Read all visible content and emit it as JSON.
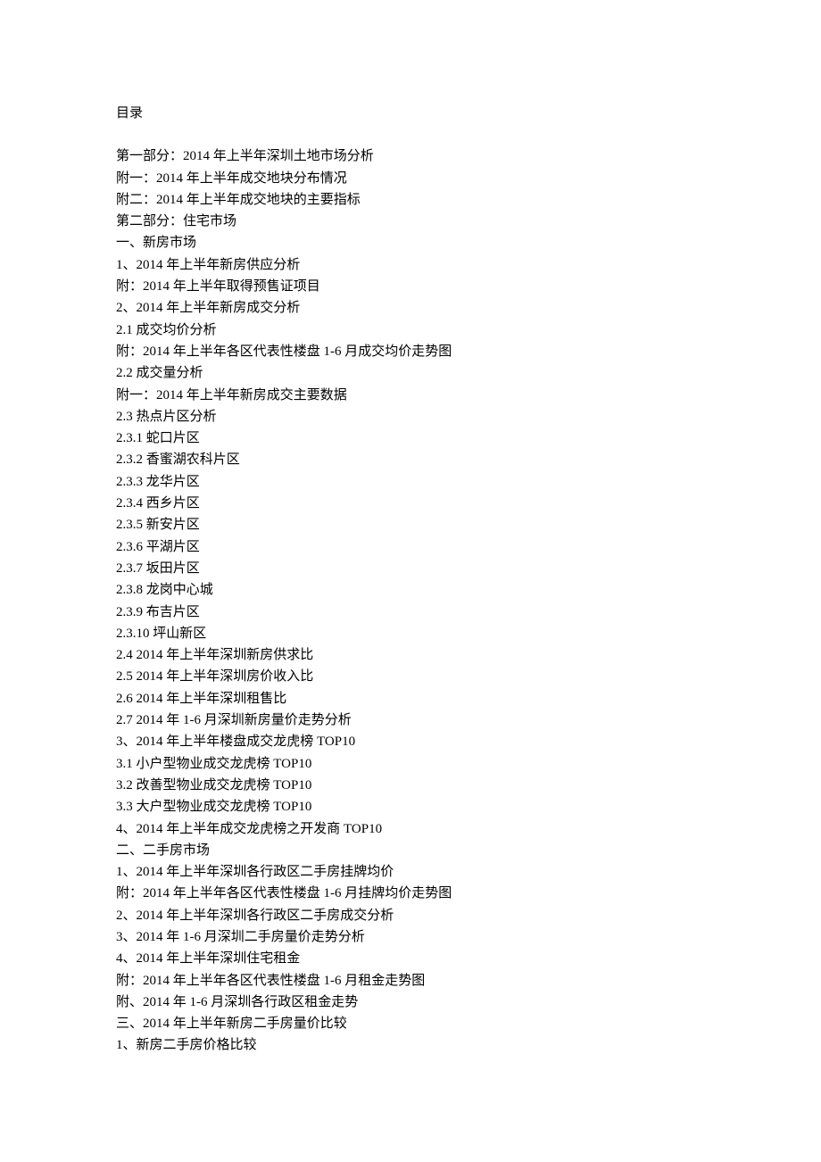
{
  "toc": {
    "title": "目录",
    "lines": [
      "第一部分：2014 年上半年深圳土地市场分析",
      "附一：2014 年上半年成交地块分布情况",
      "附二：2014 年上半年成交地块的主要指标",
      "第二部分：住宅市场",
      "一、新房市场",
      "1、2014 年上半年新房供应分析",
      "附：2014 年上半年取得预售证项目",
      "2、2014 年上半年新房成交分析",
      "2.1 成交均价分析",
      "附：2014 年上半年各区代表性楼盘 1-6 月成交均价走势图",
      "2.2 成交量分析",
      "附一：2014 年上半年新房成交主要数据",
      "2.3 热点片区分析",
      "2.3.1 蛇口片区",
      "2.3.2 香蜜湖农科片区",
      "2.3.3 龙华片区",
      "2.3.4 西乡片区",
      "2.3.5 新安片区",
      "2.3.6 平湖片区",
      "2.3.7 坂田片区",
      "2.3.8 龙岗中心城",
      "2.3.9 布吉片区",
      "2.3.10 坪山新区",
      "2.4 2014 年上半年深圳新房供求比",
      "2.5 2014 年上半年深圳房价收入比",
      "2.6 2014 年上半年深圳租售比",
      "2.7 2014 年 1-6 月深圳新房量价走势分析",
      "3、2014 年上半年楼盘成交龙虎榜 TOP10",
      "3.1 小户型物业成交龙虎榜 TOP10",
      "3.2 改善型物业成交龙虎榜 TOP10",
      "3.3 大户型物业成交龙虎榜 TOP10",
      "4、2014 年上半年成交龙虎榜之开发商 TOP10",
      "二、二手房市场",
      "1、2014 年上半年深圳各行政区二手房挂牌均价",
      "附：2014 年上半年各区代表性楼盘 1-6 月挂牌均价走势图",
      "2、2014 年上半年深圳各行政区二手房成交分析",
      "3、2014 年 1-6 月深圳二手房量价走势分析",
      "4、2014 年上半年深圳住宅租金",
      "附：2014 年上半年各区代表性楼盘 1-6 月租金走势图",
      "附、2014 年 1-6 月深圳各行政区租金走势",
      "三、2014 年上半年新房二手房量价比较",
      "1、新房二手房价格比较"
    ]
  }
}
